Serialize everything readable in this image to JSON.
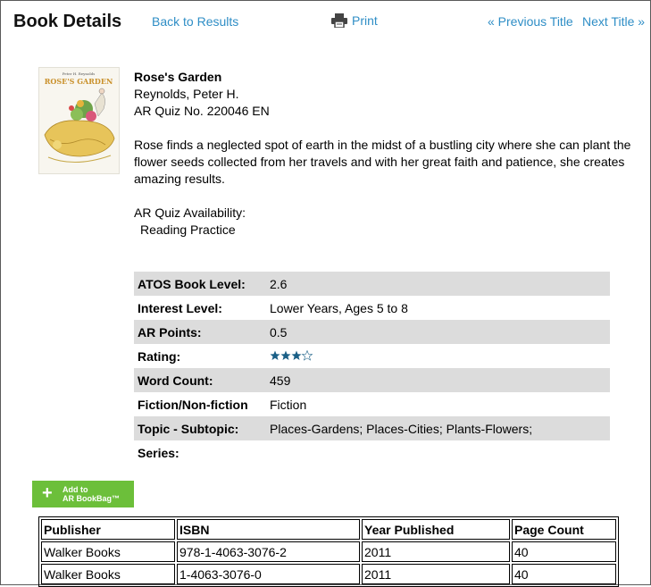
{
  "header": {
    "title": "Book Details",
    "back_link": "Back to Results",
    "print_link": "Print",
    "prev_link": "« Previous Title",
    "next_link": "Next Title »"
  },
  "book": {
    "cover_author": "Peter H. Reynolds",
    "cover_title": "ROSE'S GARDEN",
    "title": "Rose's Garden",
    "author": "Reynolds, Peter H.",
    "quiz": "AR Quiz No. 220046 EN",
    "description": "Rose finds a neglected spot of earth in the midst of a bustling city where she can plant the flower seeds collected from her travels and with her great faith and patience, she creates amazing results.",
    "availability_label": "AR Quiz Availability:",
    "availability_value": "Reading Practice"
  },
  "attributes": [
    {
      "label": "ATOS Book Level:",
      "value": "2.6"
    },
    {
      "label": "Interest Level:",
      "value": "Lower Years, Ages 5 to 8"
    },
    {
      "label": "AR Points:",
      "value": "0.5"
    },
    {
      "label": "Rating:",
      "value": "",
      "stars": 3.5
    },
    {
      "label": "Word Count:",
      "value": "459"
    },
    {
      "label": "Fiction/Non-fiction",
      "value": "Fiction"
    },
    {
      "label": "Topic - Subtopic:",
      "value": "Places-Gardens; Places-Cities; Plants-Flowers;"
    },
    {
      "label": "Series:",
      "value": ""
    }
  ],
  "bookbag": {
    "line1": "Add to",
    "line2": "AR BookBag™"
  },
  "publishers": {
    "headers": [
      "Publisher",
      "ISBN",
      "Year Published",
      "Page Count"
    ],
    "rows": [
      [
        "Walker Books",
        "978-1-4063-3076-2",
        "2011",
        "40"
      ],
      [
        "Walker Books",
        "1-4063-3076-0",
        "2011",
        "40"
      ]
    ]
  },
  "colors": {
    "link": "#2f8ec6",
    "star": "#1a5f86",
    "button": "#6cbf3a",
    "shade": "#dcdcdc"
  }
}
